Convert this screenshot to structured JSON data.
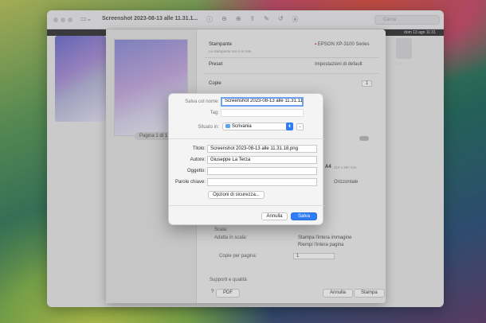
{
  "window": {
    "title": "Screenshot 2023-08-13 alle 11.31.1...",
    "search_placeholder": "Cerca",
    "menubar_clock": "dom 13 ago 11:31",
    "desktop_icon_label": "USB"
  },
  "print": {
    "printer_label": "Stampante",
    "printer_value": "EPSON XP-3100 Series",
    "printer_status": "La stampante non è in rete",
    "preset_label": "Preset",
    "preset_value": "Impostazioni di default",
    "copies_label": "Copie",
    "copies_value": "1",
    "page_indicator": "Pagina 1 di 1",
    "paper_value": "A4",
    "paper_dims": "210 x 297 mm",
    "orientation_value": "Orizzontale",
    "scale_label": "Scala:",
    "fit_label": "Adatta in scala:",
    "fit_option1": "Stampa l'intera immagine",
    "fit_option2": "Riempi l'intera pagina",
    "copies_per_page_label": "Copie per pagina:",
    "copies_per_page_value": "1",
    "section_support": "Supporti e qualità",
    "help": "?",
    "pdf_label": "PDF",
    "cancel": "Annulla",
    "print_btn": "Stampa"
  },
  "save_dialog": {
    "save_as_label": "Salva col nome:",
    "save_as_value": "Screenshot 2023-08-13 alle 11.31.11",
    "tags_label": "Tag:",
    "location_label": "Situato in:",
    "location_value": "Scrivania",
    "title_label": "Titolo:",
    "title_value": "Screenshot 2023-08-13 alle 11.31.18.png",
    "author_label": "Autore:",
    "author_value": "Giuseppe La Terza",
    "subject_label": "Oggetto:",
    "subject_value": "",
    "keywords_label": "Parole chiave:",
    "keywords_value": "",
    "security_button": "Opzioni di sicurezza...",
    "cancel": "Annulla",
    "save": "Salva"
  }
}
